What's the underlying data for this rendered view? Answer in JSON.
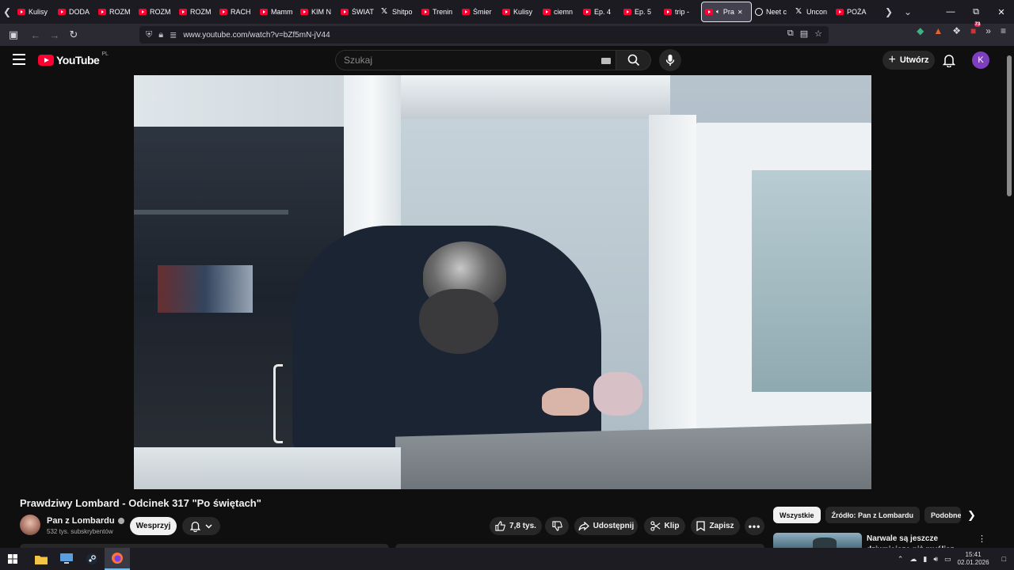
{
  "browser": {
    "tabs": [
      {
        "label": "Kulisy",
        "icon": "youtube"
      },
      {
        "label": "DODA",
        "icon": "youtube"
      },
      {
        "label": "ROZM",
        "icon": "youtube"
      },
      {
        "label": "ROZM",
        "icon": "youtube"
      },
      {
        "label": "ROZM",
        "icon": "youtube"
      },
      {
        "label": "RACH",
        "icon": "youtube"
      },
      {
        "label": "Mamm",
        "icon": "youtube"
      },
      {
        "label": "KIM N",
        "icon": "youtube"
      },
      {
        "label": "ŚWIAT",
        "icon": "youtube"
      },
      {
        "label": "Shitpo",
        "icon": "x"
      },
      {
        "label": "Trenin",
        "icon": "youtube"
      },
      {
        "label": "Śmier",
        "icon": "youtube"
      },
      {
        "label": "Kulisy",
        "icon": "youtube"
      },
      {
        "label": "ciemn",
        "icon": "youtube"
      },
      {
        "label": "Ep. 4",
        "icon": "youtube"
      },
      {
        "label": "Ep. 5",
        "icon": "youtube"
      },
      {
        "label": "trip -",
        "icon": "youtube"
      },
      {
        "label": "Pra",
        "icon": "youtube",
        "active": true
      },
      {
        "label": "Neet c",
        "icon": "mask"
      },
      {
        "label": "Uncon",
        "icon": "x"
      },
      {
        "label": "POŻA",
        "icon": "youtube"
      }
    ],
    "url": "www.youtube.com/watch?v=bZf5mN-jV44",
    "extension_badge": "73"
  },
  "youtube": {
    "logo_text": "YouTube",
    "country_code": "PL",
    "search_placeholder": "Szukaj",
    "create_label": "Utwórz",
    "avatar_letter": "K",
    "accent_color": "#ff0033"
  },
  "video": {
    "title": "Prawdziwy Lombard - Odcinek 317 \"Po świętach\"",
    "channel_name": "Pan z Lombardu",
    "subscribers": "532 tys. subskrybentów",
    "support_label": "Wesprzyj",
    "likes": "7,8 tys.",
    "share_label": "Udostępnij",
    "clip_label": "Klip",
    "save_label": "Zapisz"
  },
  "sidebar": {
    "chips": [
      "Wszystkie",
      "Źródło: Pan z Lombardu",
      "Podobne"
    ],
    "first_recommendation_title": "Narwale są jeszcze dziwniejsze niż myślisz"
  },
  "taskbar": {
    "time": "15:41",
    "date": "02.01.2026"
  }
}
